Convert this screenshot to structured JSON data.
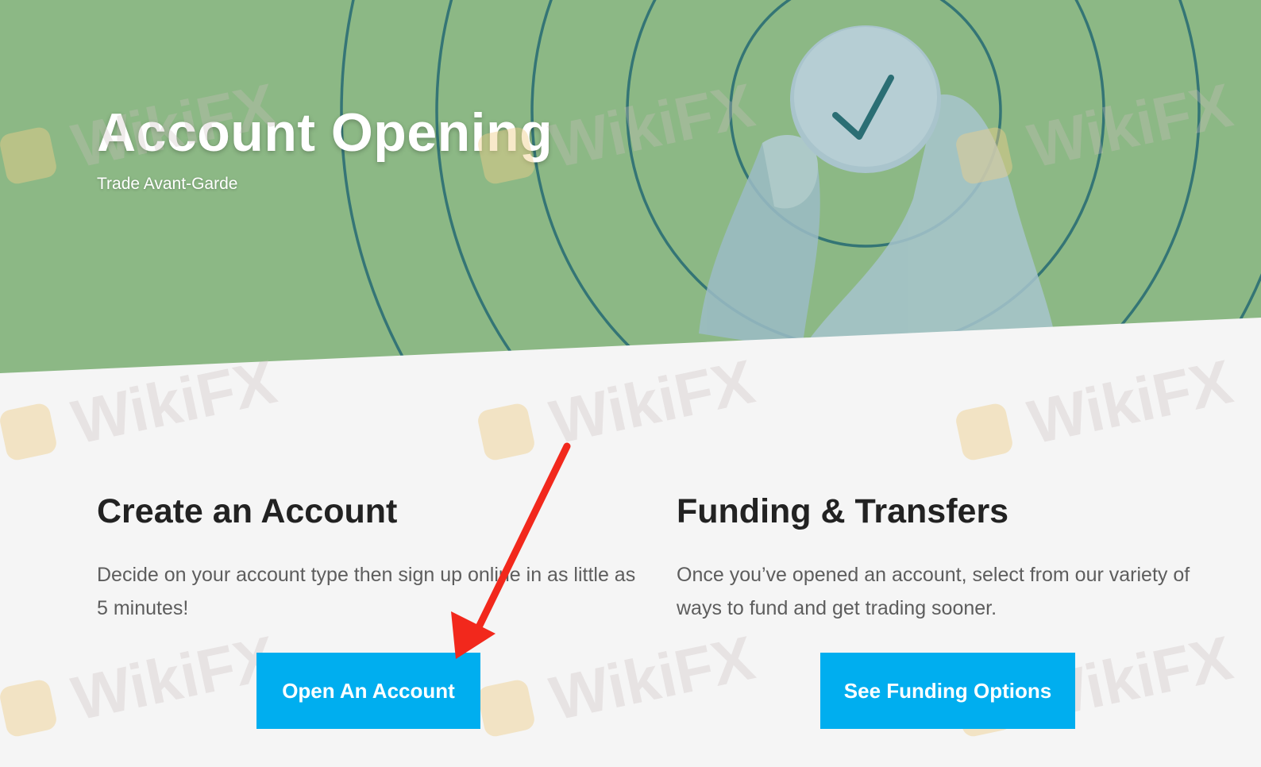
{
  "hero": {
    "title": "Account Opening",
    "subtitle": "Trade Avant-Garde"
  },
  "sections": [
    {
      "heading": "Create an Account",
      "body": "Decide on your account type then sign up online in as little as 5 minutes!",
      "button_label": "Open An Account"
    },
    {
      "heading": "Funding & Transfers",
      "body": "Once you’ve opened an account, select from our variety of ways to fund and get trading sooner.",
      "button_label": "See Funding Options"
    }
  ],
  "watermark": {
    "text": "WikiFX"
  },
  "colors": {
    "hero_green": "#8cb885",
    "ring_stroke": "#2b6e74",
    "page_bg": "#f5f5f5",
    "button": "#00aeef",
    "arrow": "#f2281c"
  }
}
